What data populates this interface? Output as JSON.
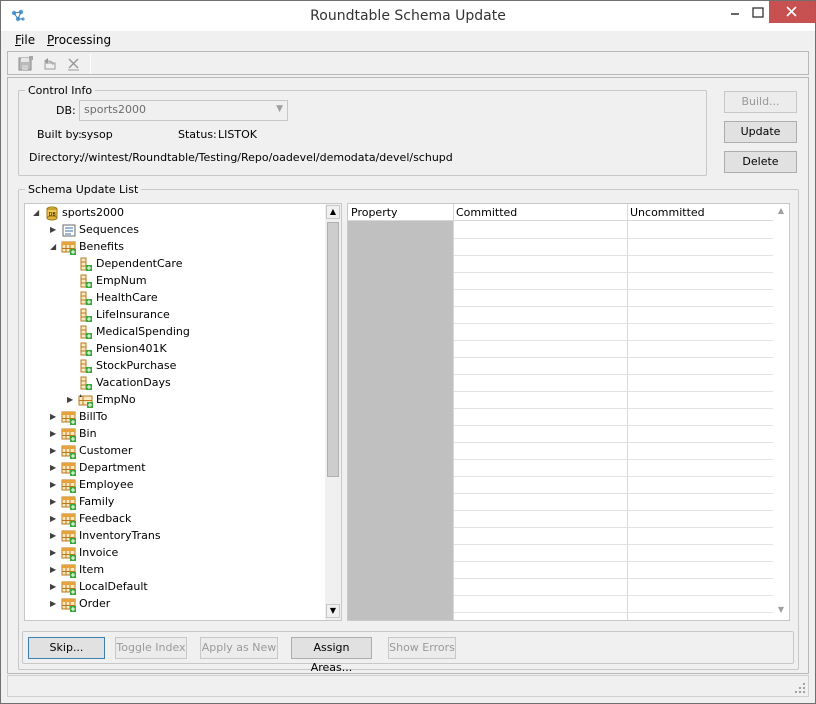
{
  "window": {
    "title": "Roundtable Schema Update",
    "minimize_glyph": "—",
    "maximize_glyph": "□",
    "close_glyph": "✕"
  },
  "menu": {
    "file_u": "F",
    "file_rest": "ile",
    "processing_u": "P",
    "processing_rest": "rocessing"
  },
  "toolbar": {
    "icons": [
      "save-icon",
      "undo-icon",
      "delete-icon"
    ]
  },
  "control_info": {
    "legend": "Control Info",
    "db_label": "DB:",
    "db_value": "sports2000",
    "built_by_label": "Built by:",
    "built_by_value": "sysop",
    "status_label": "Status:",
    "status_value": "LISTOK",
    "directory_label": "Directory:",
    "directory_value": "//wintest/Roundtable/Testing/Repo/oadevel/demodata/devel/schupd"
  },
  "side_buttons": {
    "build": "Build...",
    "update": "Update",
    "delete": "Delete"
  },
  "schema_list": {
    "legend": "Schema Update List",
    "tree": [
      {
        "label": "sports2000",
        "icon": "database-icon",
        "level": 0,
        "expander": "expanded"
      },
      {
        "label": "Sequences",
        "icon": "sequence-icon",
        "level": 1,
        "expander": "collapsed"
      },
      {
        "label": "Benefits",
        "icon": "table-icon",
        "level": 1,
        "expander": "expanded"
      },
      {
        "label": "DependentCare",
        "icon": "field-icon",
        "level": 2,
        "expander": "none"
      },
      {
        "label": "EmpNum",
        "icon": "field-icon",
        "level": 2,
        "expander": "none"
      },
      {
        "label": "HealthCare",
        "icon": "field-icon",
        "level": 2,
        "expander": "none"
      },
      {
        "label": "LifeInsurance",
        "icon": "field-icon",
        "level": 2,
        "expander": "none"
      },
      {
        "label": "MedicalSpending",
        "icon": "field-icon",
        "level": 2,
        "expander": "none"
      },
      {
        "label": "Pension401K",
        "icon": "field-icon",
        "level": 2,
        "expander": "none"
      },
      {
        "label": "StockPurchase",
        "icon": "field-icon",
        "level": 2,
        "expander": "none"
      },
      {
        "label": "VacationDays",
        "icon": "field-icon",
        "level": 2,
        "expander": "none"
      },
      {
        "label": "EmpNo",
        "icon": "index-icon",
        "level": 2,
        "expander": "collapsed"
      },
      {
        "label": "BillTo",
        "icon": "table-icon",
        "level": 1,
        "expander": "collapsed"
      },
      {
        "label": "Bin",
        "icon": "table-icon",
        "level": 1,
        "expander": "collapsed"
      },
      {
        "label": "Customer",
        "icon": "table-icon",
        "level": 1,
        "expander": "collapsed"
      },
      {
        "label": "Department",
        "icon": "table-icon",
        "level": 1,
        "expander": "collapsed"
      },
      {
        "label": "Employee",
        "icon": "table-icon",
        "level": 1,
        "expander": "collapsed"
      },
      {
        "label": "Family",
        "icon": "table-icon",
        "level": 1,
        "expander": "collapsed"
      },
      {
        "label": "Feedback",
        "icon": "table-icon",
        "level": 1,
        "expander": "collapsed"
      },
      {
        "label": "InventoryTrans",
        "icon": "table-icon",
        "level": 1,
        "expander": "collapsed"
      },
      {
        "label": "Invoice",
        "icon": "table-icon",
        "level": 1,
        "expander": "collapsed"
      },
      {
        "label": "Item",
        "icon": "table-icon",
        "level": 1,
        "expander": "collapsed"
      },
      {
        "label": "LocalDefault",
        "icon": "table-icon",
        "level": 1,
        "expander": "collapsed"
      },
      {
        "label": "Order",
        "icon": "table-icon",
        "level": 1,
        "expander": "collapsed"
      }
    ],
    "grid_columns": [
      "Property",
      "Committed",
      "Uncommitted"
    ]
  },
  "bottom_buttons": {
    "skip": "Skip...",
    "toggle_index": "Toggle Index",
    "apply_as_new": "Apply as New",
    "assign_areas": "Assign Areas...",
    "show_errors": "Show Errors"
  },
  "colors": {
    "close_button": "#c75050",
    "property_column": "#c0c0c0"
  }
}
